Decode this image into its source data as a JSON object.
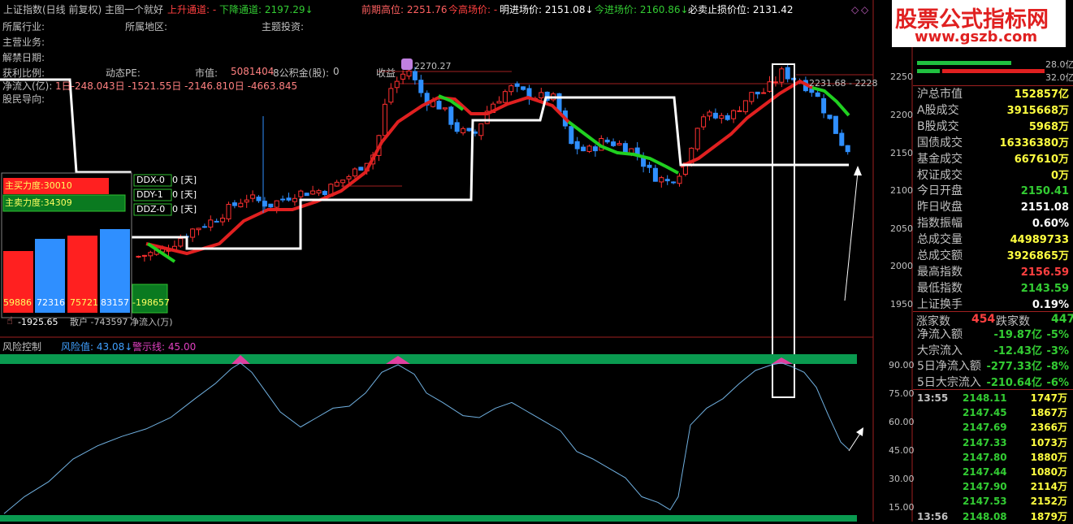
{
  "header": {
    "title": "上证指数(日线 前复权) 主图一个就好",
    "up_channel_label": "上升通道: -",
    "down_channel_label": "下降通道: 2197.29↓",
    "prev_high_label": "前期高位: 2251.76",
    "today_high_label": "今高场价: -",
    "tomorrow_in_label": "明进场价: 2151.08↓",
    "today_in_label": "今进场价: 2160.86↓",
    "stop_loss_label": "必卖止损价位: 2131.42"
  },
  "watermark": {
    "line1": "股票公式指标网",
    "line2": "www.gszb.com"
  },
  "info": {
    "industry": "所属行业:",
    "region": "所属地区:",
    "theme": "主题投资:",
    "business": "主营业务:",
    "unlock_date": "解禁日期:",
    "dividend": "获利比例:",
    "pe": "动态PE:",
    "market_cap": "市值:",
    "market_cap_value": "5081404",
    "fund": "8公积金(股):",
    "fund_value": "0",
    "income": "收益",
    "netflow": "净流入(亿):",
    "netflow_values": "1日-248.043日 -1521.55日 -2146.810日 -4663.845",
    "guide": "股民导向:"
  },
  "chart_price": {
    "peak_label": "2270.27",
    "last_label": "2231.68 - 2228",
    "price_axis": [
      "2250",
      "2200",
      "2150",
      "2100",
      "2050",
      "2000",
      "1950"
    ]
  },
  "force_panel": {
    "buy_label": "主买力度:30010",
    "sell_label": "主卖力度:34309",
    "ddx": "DDX-0",
    "ddx_unit": "0 [天]",
    "ddy": "DDY-1",
    "ddy_unit": "0 [天]",
    "ddz": "DDZ-0",
    "ddz_unit": "0 [天]",
    "bar_values": [
      "59886",
      "72316",
      "75721",
      "83157",
      "-198657"
    ],
    "bottom_left": "-1925.65",
    "bottom_mid": "散户 -743597",
    "bottom_right": "净流入(万)"
  },
  "risk_panel": {
    "title": "风险控制",
    "value_label": "风险值: 43.08↓",
    "warn_label": "警示线: 45.00",
    "axis": [
      "90.00",
      "75.00",
      "60.00",
      "45.00",
      "30.00",
      "15.00"
    ]
  },
  "right_panel": {
    "bar1_value": "28.0亿",
    "bar2_value": "32.0亿",
    "rows": [
      {
        "label": "沪总市值",
        "value": "152857亿",
        "color": "#ffff40"
      },
      {
        "label": "A股成交",
        "value": "3915668万",
        "color": "#ffff40"
      },
      {
        "label": "B股成交",
        "value": "5968万",
        "color": "#ffff40"
      },
      {
        "label": "国债成交",
        "value": "16336380万",
        "color": "#ffff40"
      },
      {
        "label": "基金成交",
        "value": "667610万",
        "color": "#ffff40"
      },
      {
        "label": "权证成交",
        "value": "0万",
        "color": "#ffff40"
      },
      {
        "label": "今日开盘",
        "value": "2150.41",
        "color": "#33cc33"
      },
      {
        "label": "昨日收盘",
        "value": "2151.08",
        "color": "#ffffff"
      },
      {
        "label": "指数振幅",
        "value": "0.60%",
        "color": "#ffffff"
      },
      {
        "label": "总成交量",
        "value": "44989733",
        "color": "#ffff40"
      },
      {
        "label": "总成交额",
        "value": "3926865万",
        "color": "#ffff40"
      },
      {
        "label": "最高指数",
        "value": "2156.59",
        "color": "#ff4040"
      },
      {
        "label": "最低指数",
        "value": "2143.59",
        "color": "#33cc33"
      },
      {
        "label": "上证换手",
        "value": "0.19%",
        "color": "#ffffff"
      }
    ],
    "updown": {
      "up_label": "涨家数",
      "up_value": "454",
      "down_label": "跌家数",
      "down_value": "447"
    },
    "flows": [
      {
        "label": "净流入额",
        "value": "-19.87亿",
        "pct": "-5%"
      },
      {
        "label": "大宗流入",
        "value": "-12.43亿",
        "pct": "-3%"
      },
      {
        "label": "5日净流入额",
        "value": "-277.33亿",
        "pct": "-8%"
      },
      {
        "label": "5日大宗流入",
        "value": "-210.64亿",
        "pct": "-6%"
      }
    ],
    "ticks": [
      {
        "time": "13:55",
        "price": "2148.11",
        "vol": "1747万"
      },
      {
        "time": "",
        "price": "2147.45",
        "vol": "1867万"
      },
      {
        "time": "",
        "price": "2147.69",
        "vol": "2366万"
      },
      {
        "time": "",
        "price": "2147.33",
        "vol": "1073万"
      },
      {
        "time": "",
        "price": "2147.80",
        "vol": "1880万"
      },
      {
        "time": "",
        "price": "2147.44",
        "vol": "1080万"
      },
      {
        "time": "",
        "price": "2147.90",
        "vol": "2114万"
      },
      {
        "time": "",
        "price": "2147.53",
        "vol": "2152万"
      },
      {
        "time": "13:56",
        "price": "2148.08",
        "vol": "1879万"
      }
    ]
  },
  "colors": {
    "up": "#ff3030",
    "down": "#2f8fff",
    "ma_up": "#e02020",
    "ma_down": "#20d020",
    "channel": "#ffffff",
    "risk_line": "#70b0e0",
    "band": "#0a9a50"
  }
}
